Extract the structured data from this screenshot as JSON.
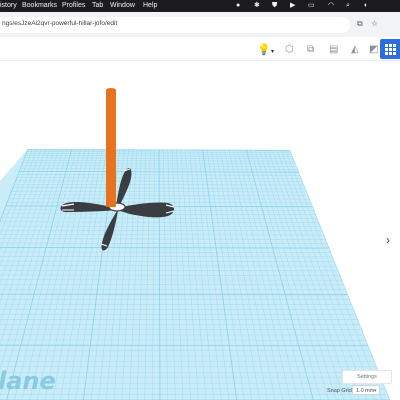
{
  "menubar": {
    "items": [
      "istory",
      "Bookmarks",
      "Profiles",
      "Tab",
      "Window",
      "Help"
    ],
    "icons": [
      "camera-icon",
      "bluetooth-icon",
      "shield-icon",
      "play-icon",
      "battery-icon",
      "wifi-icon",
      "search-icon",
      "toggle-icon"
    ]
  },
  "browser": {
    "url": "ngs/esJzeAi2qvr-powerful-hillar-jofo/edit",
    "icons": [
      "open-app-icon",
      "star-icon"
    ]
  },
  "toolbar": {
    "apps_button_color": "#2a6fdb",
    "icons": [
      "lightbulb-icon",
      "dropdown-icon",
      "group-icon",
      "ungroup-icon",
      "align-icon",
      "mirror-icon",
      "workplane-icon"
    ]
  },
  "viewport": {
    "workplane_label": "lane",
    "settings_label": "Settings",
    "snap_grid_label": "Snap Grid",
    "snap_grid_value": "1.0 mm",
    "colors": {
      "grid_fill": "#c9ecf8",
      "grid_line": "#8fd3ec",
      "shaft": "#e8731f",
      "propeller": "#3a3d42"
    }
  }
}
